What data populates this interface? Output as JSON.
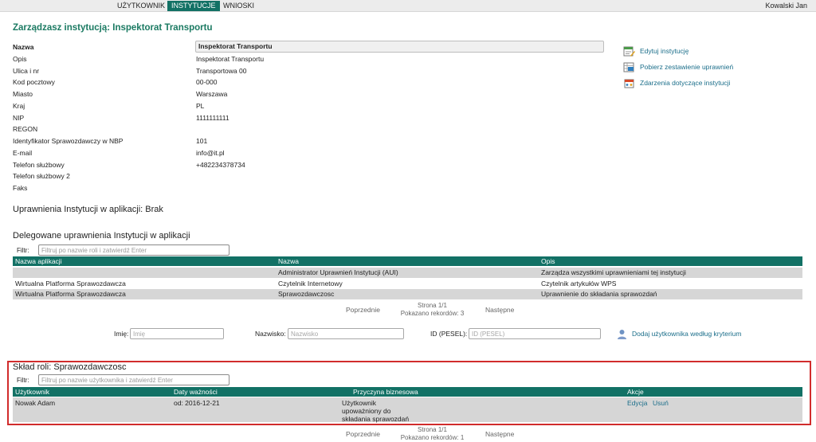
{
  "nav": {
    "tabs": [
      {
        "label": "UŻYTKOWNIK"
      },
      {
        "label": "INSTYTUCJE"
      },
      {
        "label": "WNIOSKI"
      }
    ],
    "user": "Kowalski Jan"
  },
  "page": {
    "title": "Zarządzasz instytucją: Inspektorat Transportu"
  },
  "details": {
    "name_label": "Nazwa",
    "name_value": "Inspektorat Transportu",
    "rows": [
      {
        "label": "Opis",
        "value": "Inspektorat Transportu"
      },
      {
        "label": "Ulica i nr",
        "value": "Transportowa 00"
      },
      {
        "label": "Kod pocztowy",
        "value": "00-000"
      },
      {
        "label": "Miasto",
        "value": "Warszawa"
      },
      {
        "label": "Kraj",
        "value": "PL"
      },
      {
        "label": "NIP",
        "value": "1111111111"
      },
      {
        "label": "REGON",
        "value": ""
      },
      {
        "label": "Identyfikator Sprawozdawczy w NBP",
        "value": "101"
      },
      {
        "label": "E-mail",
        "value": "info@it.pl"
      },
      {
        "label": "Telefon służbowy",
        "value": "+482234378734"
      },
      {
        "label": "Telefon służbowy 2",
        "value": ""
      },
      {
        "label": "Faks",
        "value": ""
      }
    ]
  },
  "actions": {
    "edit": "Edytuj instytucję",
    "download": "Pobierz zestawienie uprawnień",
    "events": "Zdarzenia dotyczące instytucji"
  },
  "permissions_heading": "Uprawnienia Instytucji w aplikacji: Brak",
  "delegated": {
    "heading": "Delegowane uprawnienia Instytucji w aplikacji",
    "filter_label": "Filtr:",
    "filter_placeholder": "Filtruj po nazwie roli i zatwierdź Enter",
    "columns": [
      "Nazwa aplikacji",
      "Nazwa",
      "Opis"
    ],
    "rows": [
      [
        "",
        "Administrator Uprawnień Instytucji (AUI)",
        "Zarządza wszystkimi uprawnieniami tej instytucji"
      ],
      [
        "Wirtualna Platforma Sprawozdawcza",
        "Czytelnik Internetowy",
        "Czytelnik artykułów WPS"
      ],
      [
        "Wirtualna Platforma Sprawozdawcza",
        "Sprawozdawczosc",
        "Uprawnienie do składania sprawozdań"
      ]
    ],
    "pager": {
      "prev": "Poprzednie",
      "page": "Strona 1/1",
      "count": "Pokazano rekordów: 3",
      "next": "Następne"
    }
  },
  "search": {
    "first_label": "Imię:",
    "first_placeholder": "Imię",
    "last_label": "Nazwisko:",
    "last_placeholder": "Nazwisko",
    "pesel_label": "ID (PESEL):",
    "pesel_placeholder": "ID (PESEL)",
    "add_label": "Dodaj użytkownika według kryterium"
  },
  "role": {
    "heading": "Skład roli: Sprawozdawczosc",
    "filter_label": "Filtr:",
    "filter_placeholder": "Filtruj po nazwie użytkownika i zatwierdź Enter",
    "columns": [
      "Użytkownik",
      "Daty ważności",
      "Przyczyna biznesowa",
      "Akcje"
    ],
    "rows": [
      {
        "user": "Nowak Adam",
        "dates": "od: 2016-12-21",
        "reason_lines": [
          "Użytkownik",
          "upoważniony do",
          "składania sprawozdań"
        ],
        "edit": "Edycja",
        "remove": "Usuń"
      }
    ],
    "pager": {
      "prev": "Poprzednie",
      "page": "Strona 1/1",
      "count": "Pokazano rekordów: 1",
      "next": "Następne"
    }
  },
  "colors": {
    "accent": "#127165",
    "title": "#1b7a62",
    "link": "#1b6e8a",
    "highlight_border": "#d12c2c"
  },
  "icons": {
    "edit": "edit-document-icon",
    "download": "spreadsheet-download-icon",
    "events": "events-list-icon",
    "add_user": "user-icon"
  }
}
